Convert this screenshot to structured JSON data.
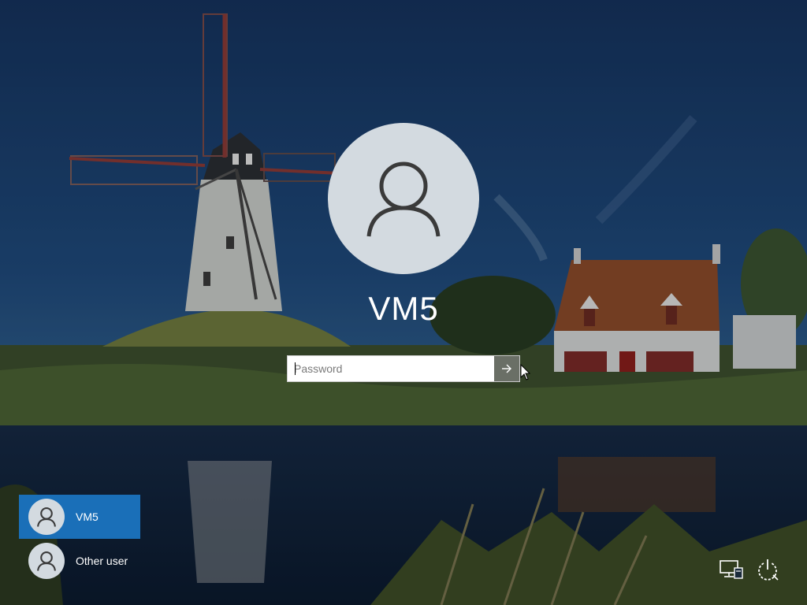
{
  "lock_screen": {
    "account_name": "VM5",
    "password_placeholder": "Password"
  },
  "user_list": [
    {
      "label": "VM5",
      "selected": true
    },
    {
      "label": "Other user",
      "selected": false
    }
  ],
  "icons": {
    "avatar": "user-silhouette-icon",
    "submit": "arrow-right-icon",
    "network": "network-icon",
    "accessibility": "ease-of-access-icon",
    "power": "power-icon"
  },
  "colors": {
    "selected_user_bg": "#1a6fb8",
    "avatar_bg": "#d3dae0",
    "submit_button_bg": "#6a6f66"
  }
}
